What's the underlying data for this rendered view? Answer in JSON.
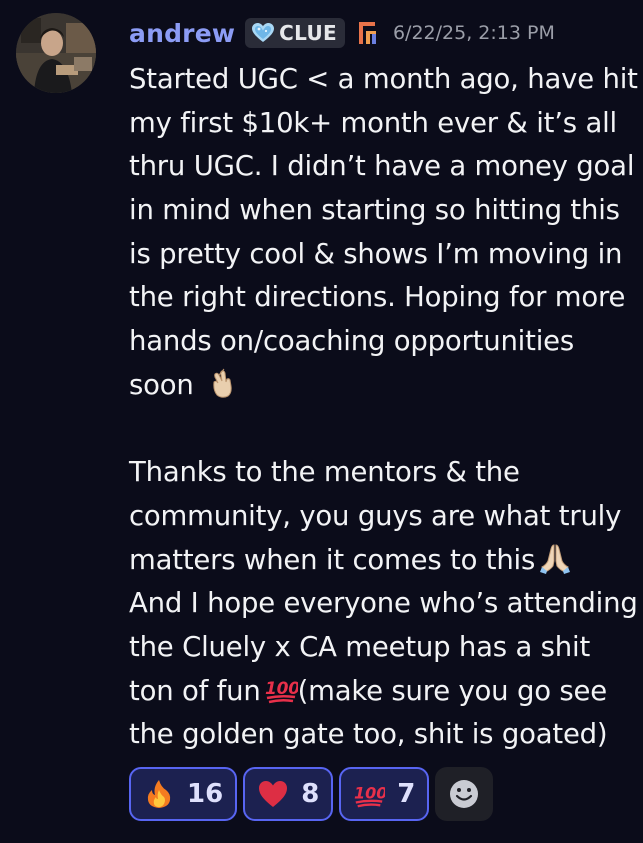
{
  "message": {
    "author": "andrew",
    "guild_tag": "CLUE",
    "timestamp": "6/22/25, 2:13 PM",
    "lines": [
      "Started UGC < a month ago, have hit",
      "my first $10k+ month ever & it’s all",
      "thru UGC. I didn’t have a money goal",
      "in mind when starting so hitting this",
      "is pretty cool & shows I’m moving in",
      "the right directions. Hoping for more",
      "hands on/coaching opportunities",
      "soon",
      "",
      "Thanks to the mentors & the",
      "community, you guys are what truly",
      "matters when it comes to this",
      "And I hope everyone who’s attending",
      "the Cluely x CA meetup has a shit",
      "ton of fun",
      "(make sure you go see",
      "the golden gate too, shit is goated)"
    ],
    "inline_emoji": {
      "soon": "crossed-fingers-emoji",
      "this": "folded-hands-emoji",
      "fun": "hundred-points-emoji"
    }
  },
  "reactions": [
    {
      "emoji": "fire-emoji",
      "count": "16"
    },
    {
      "emoji": "red-heart-emoji",
      "count": "8"
    },
    {
      "emoji": "hundred-points-emoji",
      "count": "7"
    }
  ],
  "colors": {
    "background": "#0b0c1a",
    "username": "#8c9cf5",
    "reaction_border": "#5865f2",
    "reaction_bg": "#1c2150"
  }
}
